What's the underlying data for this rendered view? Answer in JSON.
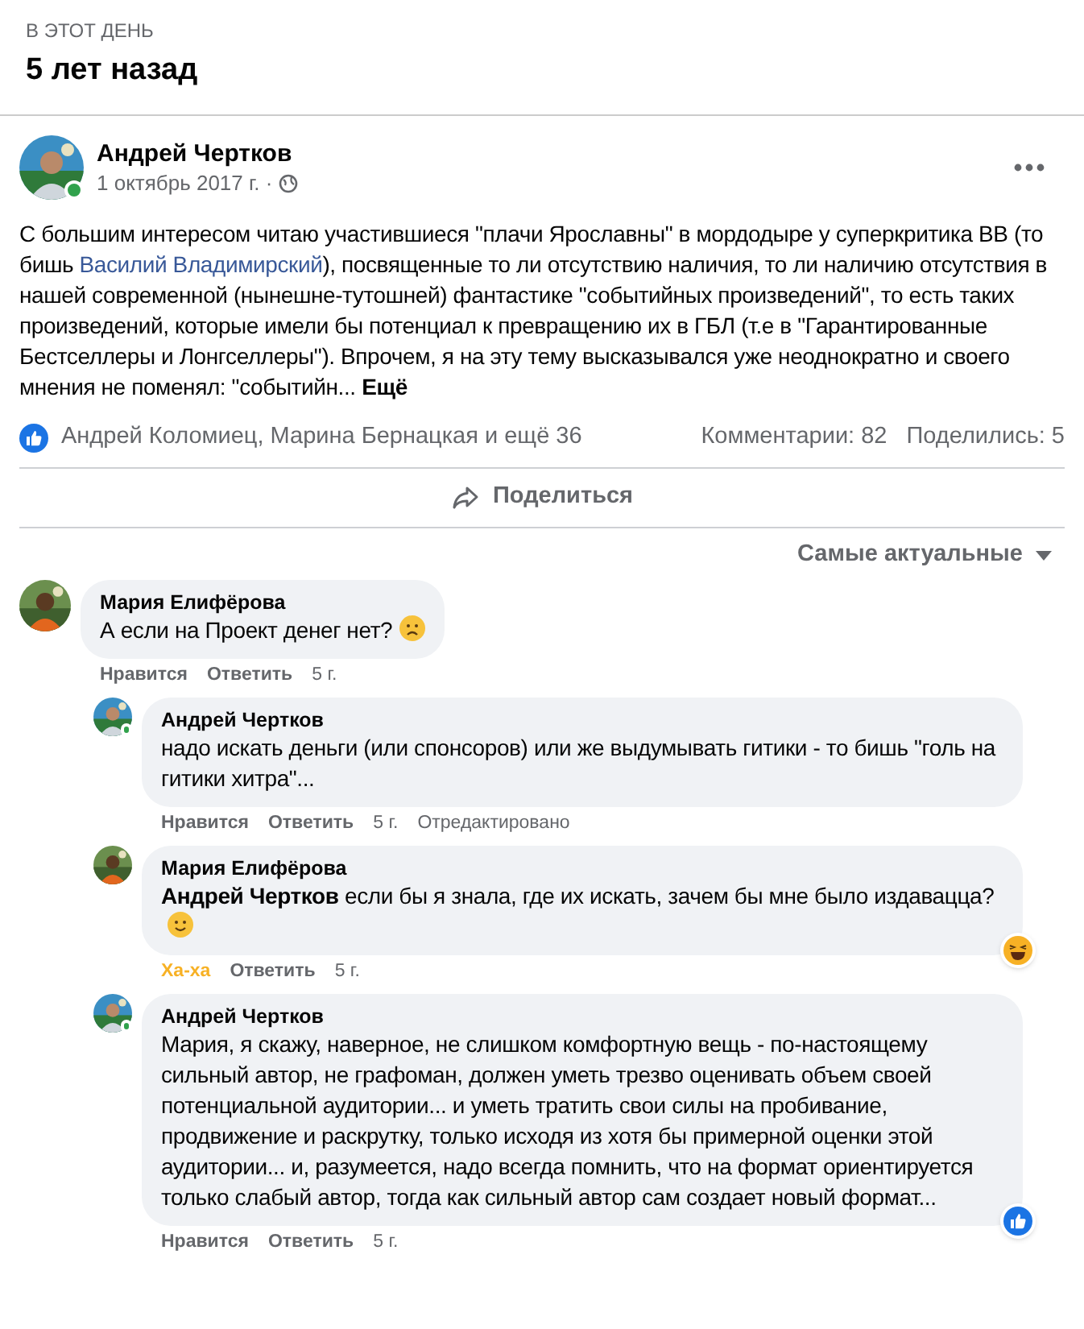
{
  "memory": {
    "eyebrow": "В ЭТОТ ДЕНЬ",
    "title": "5 лет назад"
  },
  "post": {
    "author": "Андрей Чертков",
    "online": true,
    "date": "1 октябрь 2017 г. ·",
    "text_parts": [
      {
        "kind": "text",
        "text": "С большим интересом читаю участившиеся \"плачи Ярославны\" в мордодыре у суперкритика ВВ (то бишь "
      },
      {
        "kind": "link",
        "text": "Василий Владимирский"
      },
      {
        "kind": "text",
        "text": "), посвященные то ли отсутствию наличия, то ли наличию отсутствия в нашей современной (нынешне-тутошней) фантастике \"событийных произведений\", то есть таких произведений, которые имели бы потенциал к превращению их в ГБЛ (т.е в \"Гарантированные Бестселлеры и Лонгселлеры\"). Впрочем, я на эту тему высказывался уже неоднократно и своего мнения не поменял: \"событийн... "
      },
      {
        "kind": "more",
        "text": "Ещё"
      }
    ],
    "reactions_text": "Андрей Коломиец, Марина Бернацкая и ещё 36",
    "comments_count": "Комментарии: 82",
    "shares_count": "Поделились: 5",
    "share_button": "Поделиться"
  },
  "sort": "Самые актуальные",
  "comments": [
    {
      "author": "Мария Елифёрова",
      "text": "А если на Проект денег нет?",
      "end_emoji": {
        "kind": "frown"
      },
      "like_label": "Нравится",
      "reacted": false,
      "reply_label": "Ответить",
      "time": "5 г.",
      "children": [
        {
          "author": "Андрей Чертков",
          "online": true,
          "text": "надо искать деньги (или спонсоров) или же выдумывать гитики - то бишь \"голь на гитики хитра\"...",
          "like_label": "Нравится",
          "reacted": false,
          "reply_label": "Ответить",
          "time": "5 г.",
          "edited": "Отредактировано"
        },
        {
          "author": "Мария Елифёрова",
          "text": "**Андрей Чертков** если бы я знала, где их искать, зачем бы мне было издавацца?",
          "end_emoji": {
            "kind": "smile"
          },
          "reaction_badge": {
            "kind": "haha"
          },
          "like_label": "Ха-ха",
          "reacted": true,
          "reply_label": "Ответить",
          "time": "5 г."
        },
        {
          "author": "Андрей Чертков",
          "online": true,
          "text": "Мария, я скажу, наверное, не слишком комфортную вещь - по-настоящему сильный автор, не графоман, должен уметь трезво оценивать объем своей потенциальной аудитории... и уметь тратить свои силы на пробивание, продвижение и раскрутку, только исходя из хотя бы примерной оценки этой аудитории... и, разумеется, надо всегда помнить, что на формат ориентируется только слабый автор, тогда как сильный автор сам создает новый формат...",
          "reaction_badge": {
            "kind": "like"
          },
          "like_label": "Нравится",
          "reacted": false,
          "reply_label": "Ответить",
          "time": "5 г."
        }
      ]
    }
  ]
}
